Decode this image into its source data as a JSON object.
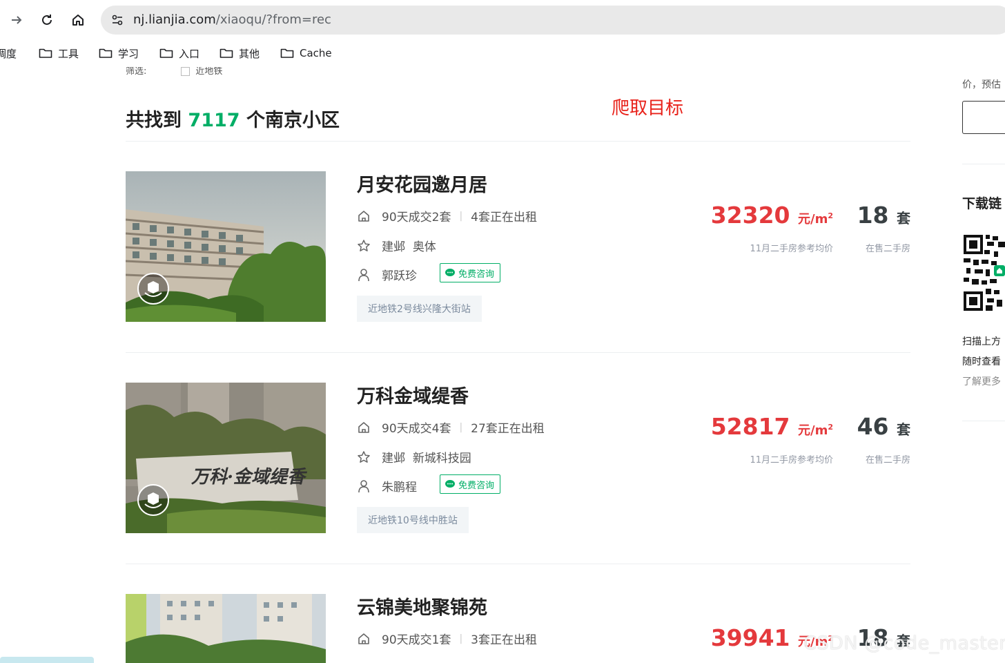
{
  "browser": {
    "url_host": "nj.lianjia.com",
    "url_path": "/xiaoqu/?from=rec",
    "bookmarks": [
      {
        "label": "调度",
        "icon": "folder-icon"
      },
      {
        "label": "工具",
        "icon": "folder-icon"
      },
      {
        "label": "学习",
        "icon": "folder-icon"
      },
      {
        "label": "入口",
        "icon": "folder-icon"
      },
      {
        "label": "其他",
        "icon": "folder-icon"
      },
      {
        "label": "Cache",
        "icon": "folder-icon"
      }
    ]
  },
  "filter": {
    "label": "筛选:",
    "option": "近地铁"
  },
  "result": {
    "prefix": "共找到",
    "count": "7117",
    "suffix": "个南京小区"
  },
  "annotation": "爬取目标",
  "listings": [
    {
      "name": "月安花园邀月居",
      "deals": "90天成交2套",
      "rent": "4套正在出租",
      "district": "建邺",
      "area": "奥体",
      "agent": "郭跃珍",
      "consult_label": "免费咨询",
      "tag": "近地铁2号线兴隆大街站",
      "price": "32320",
      "price_unit": "元/m",
      "price_unit_sup": "2",
      "price_caption": "11月二手房参考均价",
      "on_sale": "18",
      "on_sale_unit": "套",
      "on_sale_caption": "在售二手房"
    },
    {
      "name": "万科金域缇香",
      "deals": "90天成交4套",
      "rent": "27套正在出租",
      "district": "建邺",
      "area": "新城科技园",
      "agent": "朱鹏程",
      "consult_label": "免费咨询",
      "tag": "近地铁10号线中胜站",
      "price": "52817",
      "price_unit": "元/m",
      "price_unit_sup": "2",
      "price_caption": "11月二手房参考均价",
      "on_sale": "46",
      "on_sale_unit": "套",
      "on_sale_caption": "在售二手房"
    },
    {
      "name": "云锦美地聚锦苑",
      "deals": "90天成交1套",
      "rent": "3套正在出租",
      "price": "39941",
      "price_unit": "元/m",
      "price_unit_sup": "2",
      "on_sale": "18",
      "on_sale_unit": "套"
    }
  ],
  "sidebar": {
    "text_top": "价，预估",
    "download_title": "下载链",
    "lines": [
      "扫描上方",
      "随时查看",
      "了解更多"
    ]
  },
  "watermark": "CSDN @code_master1"
}
